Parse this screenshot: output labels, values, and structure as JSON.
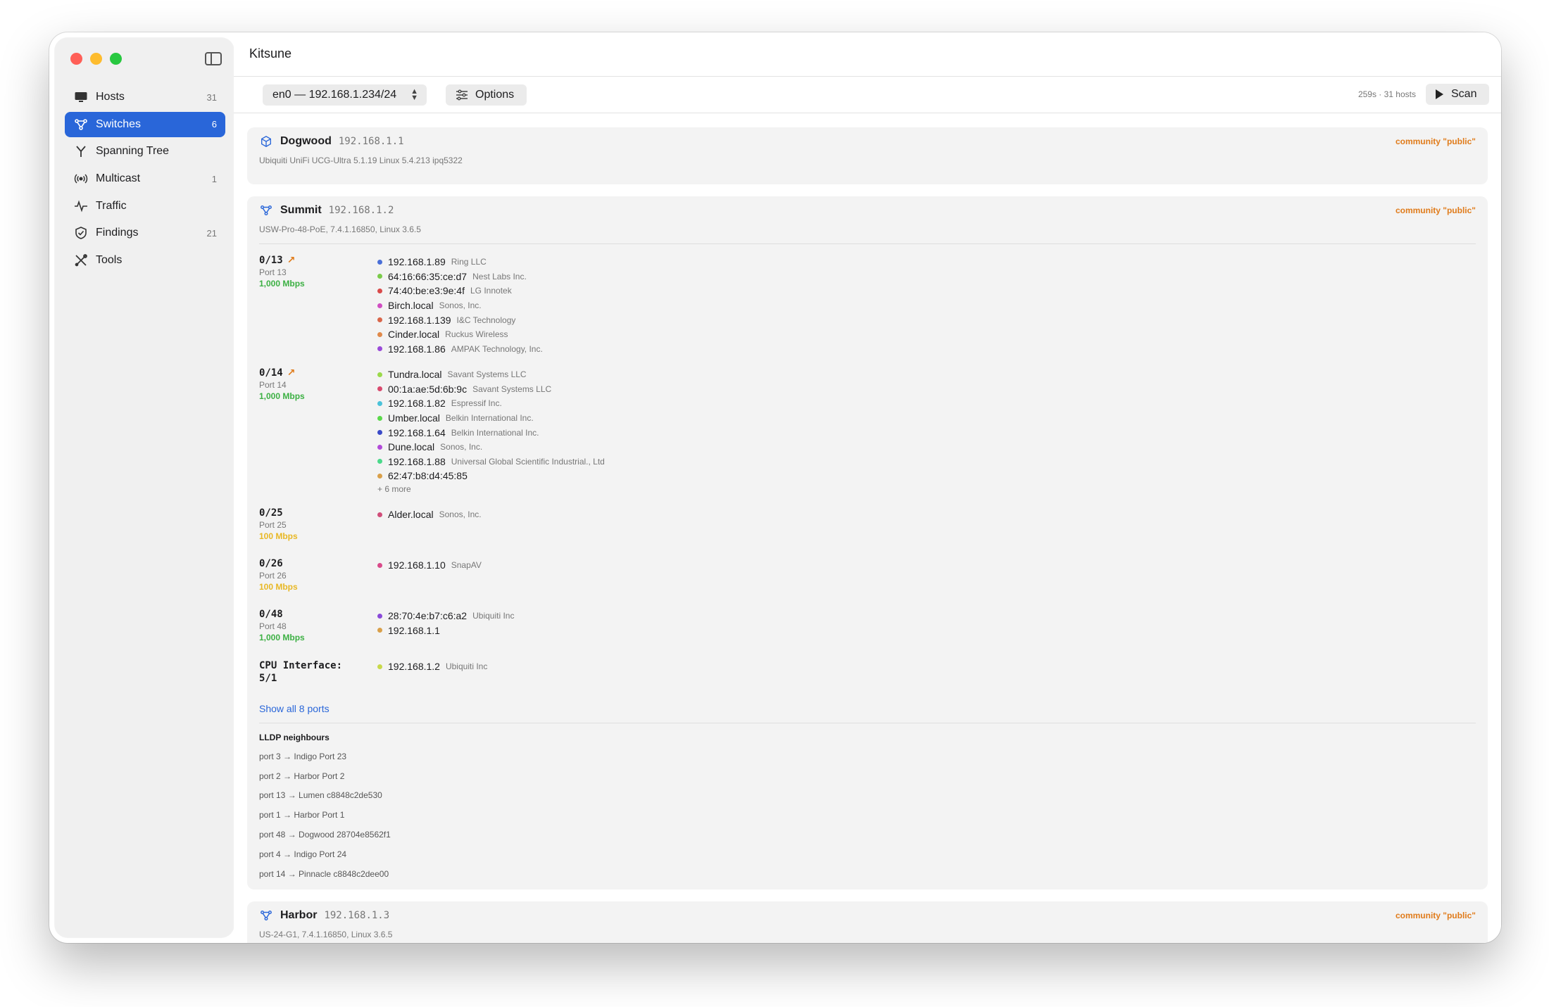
{
  "app": {
    "title": "Kitsune"
  },
  "sidebar": {
    "items": [
      {
        "label": "Hosts",
        "count": "31",
        "icon": "monitor-icon"
      },
      {
        "label": "Switches",
        "count": "6",
        "icon": "network-icon",
        "active": true
      },
      {
        "label": "Spanning Tree",
        "count": "",
        "icon": "fork-icon"
      },
      {
        "label": "Multicast",
        "count": "1",
        "icon": "broadcast-icon"
      },
      {
        "label": "Traffic",
        "count": "",
        "icon": "pulse-icon"
      },
      {
        "label": "Findings",
        "count": "21",
        "icon": "shield-check-icon"
      },
      {
        "label": "Tools",
        "count": "",
        "icon": "tools-icon"
      }
    ]
  },
  "toolbar": {
    "interface": "en0 — 192.168.1.234/24",
    "options_label": "Options",
    "status": "259s · 31 hosts",
    "scan_label": "Scan"
  },
  "colors": {
    "accent": "#2966d9",
    "community": "#e07b1a",
    "speed_1000": "#3cb043",
    "speed_100": "#e8b825"
  },
  "devices": [
    {
      "name": "Dogwood",
      "ip": "192.168.1.1",
      "community": "community \"public\"",
      "subtitle": "Ubiquiti UniFi UCG-Ultra 5.1.19 Linux 5.4.213 ipq5322"
    },
    {
      "name": "Summit",
      "ip": "192.168.1.2",
      "community": "community \"public\"",
      "subtitle": "USW-Pro-48-PoE, 7.4.1.16850, Linux 3.6.5",
      "ports": [
        {
          "name": "0/13",
          "label": "Port 13",
          "speed": "1,000 Mbps",
          "uplink": true,
          "hosts": [
            {
              "name": "192.168.1.89",
              "vendor": "Ring LLC",
              "color": "#4a6fd8"
            },
            {
              "name": "64:16:66:35:ce:d7",
              "vendor": "Nest Labs Inc.",
              "color": "#7acb4a"
            },
            {
              "name": "74:40:be:e3:9e:4f",
              "vendor": "LG Innotek",
              "color": "#d94a4a"
            },
            {
              "name": "Birch.local",
              "vendor": "Sonos, Inc.",
              "color": "#d04ec2"
            },
            {
              "name": "192.168.1.139",
              "vendor": "I&C Technology",
              "color": "#d9664a"
            },
            {
              "name": "Cinder.local",
              "vendor": "Ruckus Wireless",
              "color": "#e0894a"
            },
            {
              "name": "192.168.1.86",
              "vendor": "AMPAK Technology, Inc.",
              "color": "#9a4ad9"
            }
          ],
          "more": ""
        },
        {
          "name": "0/14",
          "label": "Port 14",
          "speed": "1,000 Mbps",
          "uplink": true,
          "hosts": [
            {
              "name": "Tundra.local",
              "vendor": "Savant Systems LLC",
              "color": "#9ad94a"
            },
            {
              "name": "00:1a:ae:5d:6b:9c",
              "vendor": "Savant Systems LLC",
              "color": "#d94a6e"
            },
            {
              "name": "192.168.1.82",
              "vendor": "Espressif Inc.",
              "color": "#4ac2d9"
            },
            {
              "name": "Umber.local",
              "vendor": "Belkin International Inc.",
              "color": "#5ad94a"
            },
            {
              "name": "192.168.1.64",
              "vendor": "Belkin International Inc.",
              "color": "#3a4ac8"
            },
            {
              "name": "Dune.local",
              "vendor": "Sonos, Inc.",
              "color": "#b24ad9"
            },
            {
              "name": "192.168.1.88",
              "vendor": "Universal Global Scientific Industrial., Ltd",
              "color": "#4ad98a"
            },
            {
              "name": "62:47:b8:d4:45:85",
              "vendor": "",
              "color": "#d9a04a"
            }
          ],
          "more": "+ 6 more"
        },
        {
          "name": "0/25",
          "label": "Port 25",
          "speed": "100 Mbps",
          "uplink": false,
          "hosts": [
            {
              "name": "Alder.local",
              "vendor": "Sonos, Inc.",
              "color": "#d04e7a"
            }
          ],
          "more": ""
        },
        {
          "name": "0/26",
          "label": "Port 26",
          "speed": "100 Mbps",
          "uplink": false,
          "hosts": [
            {
              "name": "192.168.1.10",
              "vendor": "SnapAV",
              "color": "#d94a8a"
            }
          ],
          "more": ""
        },
        {
          "name": "0/48",
          "label": "Port 48",
          "speed": "1,000 Mbps",
          "uplink": false,
          "hosts": [
            {
              "name": "28:70:4e:b7:c6:a2",
              "vendor": "Ubiquiti Inc",
              "color": "#8a4ad9"
            },
            {
              "name": "192.168.1.1",
              "vendor": "",
              "color": "#d9a04a"
            }
          ],
          "more": ""
        },
        {
          "name": "CPU Interface:\n5/1",
          "label": "",
          "speed": "",
          "uplink": false,
          "hosts": [
            {
              "name": "192.168.1.2",
              "vendor": "Ubiquiti Inc",
              "color": "#c8d94a"
            }
          ],
          "more": ""
        }
      ],
      "show_all": "Show all 8 ports",
      "lldp_title": "LLDP neighbours",
      "lldp": [
        "port 3 → Indigo Port 23",
        "port 2 → Harbor Port 2",
        "port 13 → Lumen c8848c2de530",
        "port 1 → Harbor Port 1",
        "port 48 → Dogwood 28704e8562f1",
        "port 4 → Indigo Port 24",
        "port 14 → Pinnacle c8848c2dee00"
      ]
    },
    {
      "name": "Harbor",
      "ip": "192.168.1.3",
      "community": "community \"public\"",
      "subtitle": "US-24-G1, 7.4.1.16850, Linux 3.6.5"
    }
  ]
}
